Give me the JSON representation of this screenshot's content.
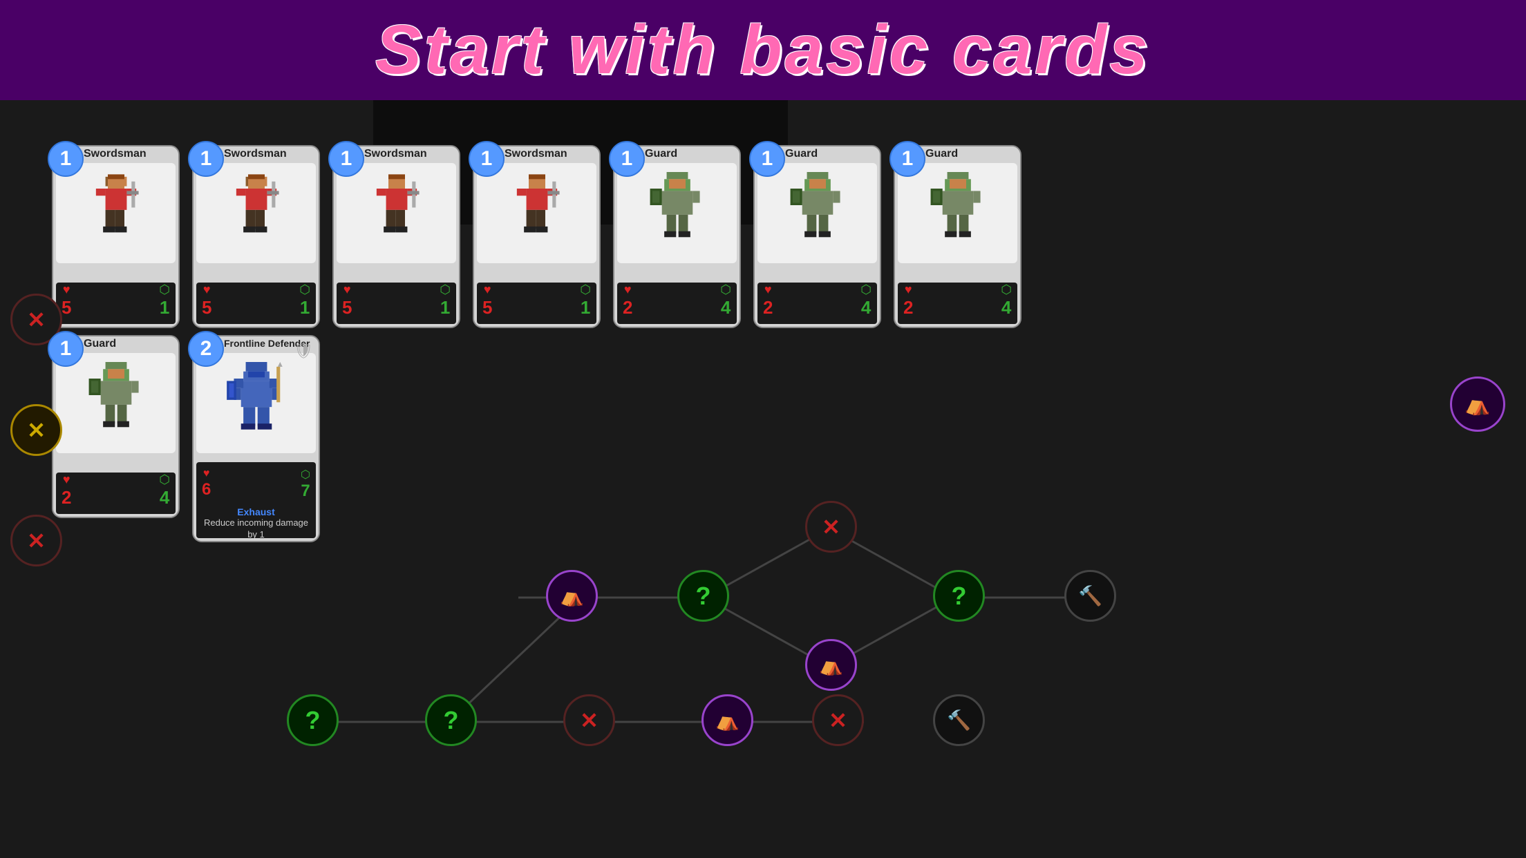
{
  "header": {
    "title": "Start with basic cards",
    "bg_color": "#4a0066"
  },
  "cards_row1": [
    {
      "id": "swordsman-1",
      "cost": "1",
      "name": "Swordsman",
      "type": "swordsman",
      "attack": "5",
      "defense": "1",
      "desc": ""
    },
    {
      "id": "swordsman-2",
      "cost": "1",
      "name": "Swordsman",
      "type": "swordsman",
      "attack": "5",
      "defense": "1",
      "desc": ""
    },
    {
      "id": "swordsman-3",
      "cost": "1",
      "name": "Swordsman",
      "type": "swordsman",
      "attack": "5",
      "defense": "1",
      "desc": ""
    },
    {
      "id": "swordsman-4",
      "cost": "1",
      "name": "Swordsman",
      "type": "swordsman",
      "attack": "5",
      "defense": "1",
      "desc": ""
    },
    {
      "id": "guard-1",
      "cost": "1",
      "name": "Guard",
      "type": "guard",
      "attack": "2",
      "defense": "4",
      "desc": ""
    },
    {
      "id": "guard-2",
      "cost": "1",
      "name": "Guard",
      "type": "guard",
      "attack": "2",
      "defense": "4",
      "desc": ""
    },
    {
      "id": "guard-3",
      "cost": "1",
      "name": "Guard",
      "type": "guard",
      "attack": "2",
      "defense": "4",
      "desc": ""
    }
  ],
  "cards_row2": [
    {
      "id": "guard-row2-1",
      "cost": "1",
      "name": "Guard",
      "type": "guard",
      "attack": "2",
      "defense": "4",
      "desc": ""
    },
    {
      "id": "frontline-defender",
      "cost": "2",
      "name": "Frontline Defender",
      "type": "frontline",
      "attack": "6",
      "defense": "7",
      "has_shield": true,
      "exhaust_label": "Exhaust",
      "exhaust_text": "Reduce incoming damage by 1"
    }
  ],
  "map_nodes": {
    "left_col_row1": {
      "type": "battle",
      "symbol": "✕"
    },
    "left_col_row2": {
      "type": "battle_gold",
      "symbol": "✕"
    },
    "left_col_row3": {
      "type": "battle",
      "symbol": "✕"
    },
    "nodes": [
      {
        "type": "camp",
        "symbol": "⛺",
        "color": "#aa44cc"
      },
      {
        "type": "question",
        "symbol": "?",
        "color": "#22aa22"
      },
      {
        "type": "battle",
        "symbol": "✕",
        "color": "#cc2222"
      },
      {
        "type": "camp2",
        "symbol": "⛺",
        "color": "#aa44cc"
      },
      {
        "type": "question2",
        "symbol": "?",
        "color": "#22aa22"
      },
      {
        "type": "shop",
        "symbol": "🔨",
        "color": "#555555"
      },
      {
        "type": "question3",
        "symbol": "?",
        "color": "#22aa22"
      },
      {
        "type": "camp3",
        "symbol": "⛺",
        "color": "#aa44cc"
      },
      {
        "type": "battle2",
        "symbol": "✕",
        "color": "#cc2222"
      },
      {
        "type": "question4",
        "symbol": "?",
        "color": "#22aa22"
      }
    ]
  },
  "colors": {
    "header_bg": "#4a0066",
    "title_color": "#ff69b4",
    "card_bg": "#c8c8c8",
    "cost_badge": "#5599ff",
    "attack_color": "#dd2222",
    "defense_color": "#33aa33",
    "exhaust_color": "#4488ff",
    "game_bg": "#1a1a1a"
  }
}
